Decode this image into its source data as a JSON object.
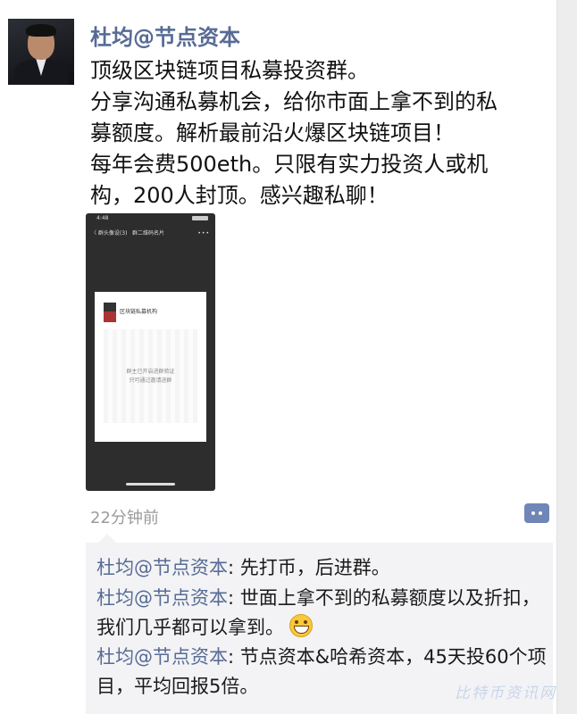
{
  "post": {
    "author": "杜均@节点资本",
    "lines": [
      "顶级区块链项目私募投资群。",
      "分享沟通私募机会，给你市面上拿不到的私",
      "募额度。解析最前沿火爆区块链项目！",
      "每年会费500eth。只限有实力投资人或机",
      "构，200人封顶。感兴趣私聊！"
    ],
    "time": "22分钟前",
    "shared_image": {
      "status_time": "4:48",
      "nav_back": "〈 群头像设(3)",
      "nav_title": "群二维码名片",
      "nav_more": "•••",
      "group_name": "区块链私募机构",
      "expired_line1": "群主已开启进群验证",
      "expired_line2": "只可通过邀请进群"
    }
  },
  "comments": [
    {
      "name": "杜均@节点资本",
      "text": ": 先打币，后进群。"
    },
    {
      "name": "杜均@节点资本",
      "text": ": 世面上拿不到的私募额度以及折扣，我们几乎都可以拿到。"
    },
    {
      "name": "杜均@节点资本",
      "text": ": 节点资本&哈希资本，45天投60个项目，平均回报5倍。"
    }
  ],
  "icons": {
    "comment": "comment-bubble-icon",
    "emoji": "grinning-emoji-icon"
  },
  "colors": {
    "link": "#576b95",
    "comment_bg": "#f3f3f5",
    "comment_button": "#6f86b7",
    "time": "#9b9b9b"
  },
  "watermark": "比特币资讯网"
}
